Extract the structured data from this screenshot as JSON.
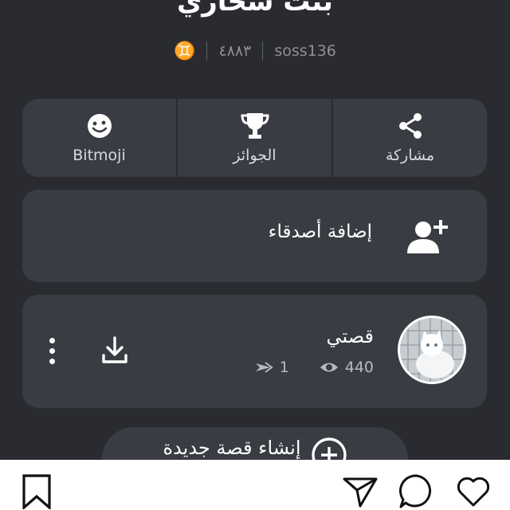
{
  "profile": {
    "name": "بنت سحاري",
    "username": "soss136",
    "score": "٤٨٨٣",
    "zodiac": "♊"
  },
  "actions": {
    "share_label": "مشاركة",
    "awards_label": "الجوائز",
    "bitmoji_label": "Bitmoji"
  },
  "add_friends": {
    "label": "إضافة أصدقاء"
  },
  "story": {
    "title": "قصتي",
    "views": "440",
    "screenshots": "1"
  },
  "new_story": {
    "label": "إنشاء قصة جديدة"
  },
  "colors": {
    "background": "#292b30",
    "card": "#393c42",
    "bottom_bar": "#ffffff"
  },
  "icons": [
    "share-icon",
    "trophy-icon",
    "bitmoji-icon",
    "add-friend-icon",
    "eye-icon",
    "screenshot-icon",
    "download-icon",
    "more-icon",
    "plus-circle-icon",
    "bookmark-icon",
    "send-icon",
    "comment-icon",
    "heart-icon"
  ]
}
